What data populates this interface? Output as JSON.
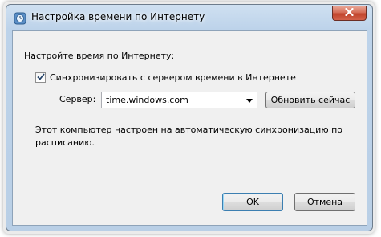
{
  "window": {
    "title": "Настройка времени по Интернету",
    "close_icon": "close-icon",
    "app_icon": "clock-globe-icon"
  },
  "dialog": {
    "heading": "Настройте время по Интернету:",
    "sync_checkbox": {
      "label": "Синхронизировать с сервером времени в Интернете",
      "checked": true
    },
    "server_label": "Сервер:",
    "server_value": "time.windows.com",
    "update_button": "Обновить сейчас",
    "status_text_line1": "Этот компьютер настроен на автоматическую синхронизацию по",
    "status_text_line2": "расписанию."
  },
  "buttons": {
    "ok": "OK",
    "cancel": "Отмена"
  }
}
